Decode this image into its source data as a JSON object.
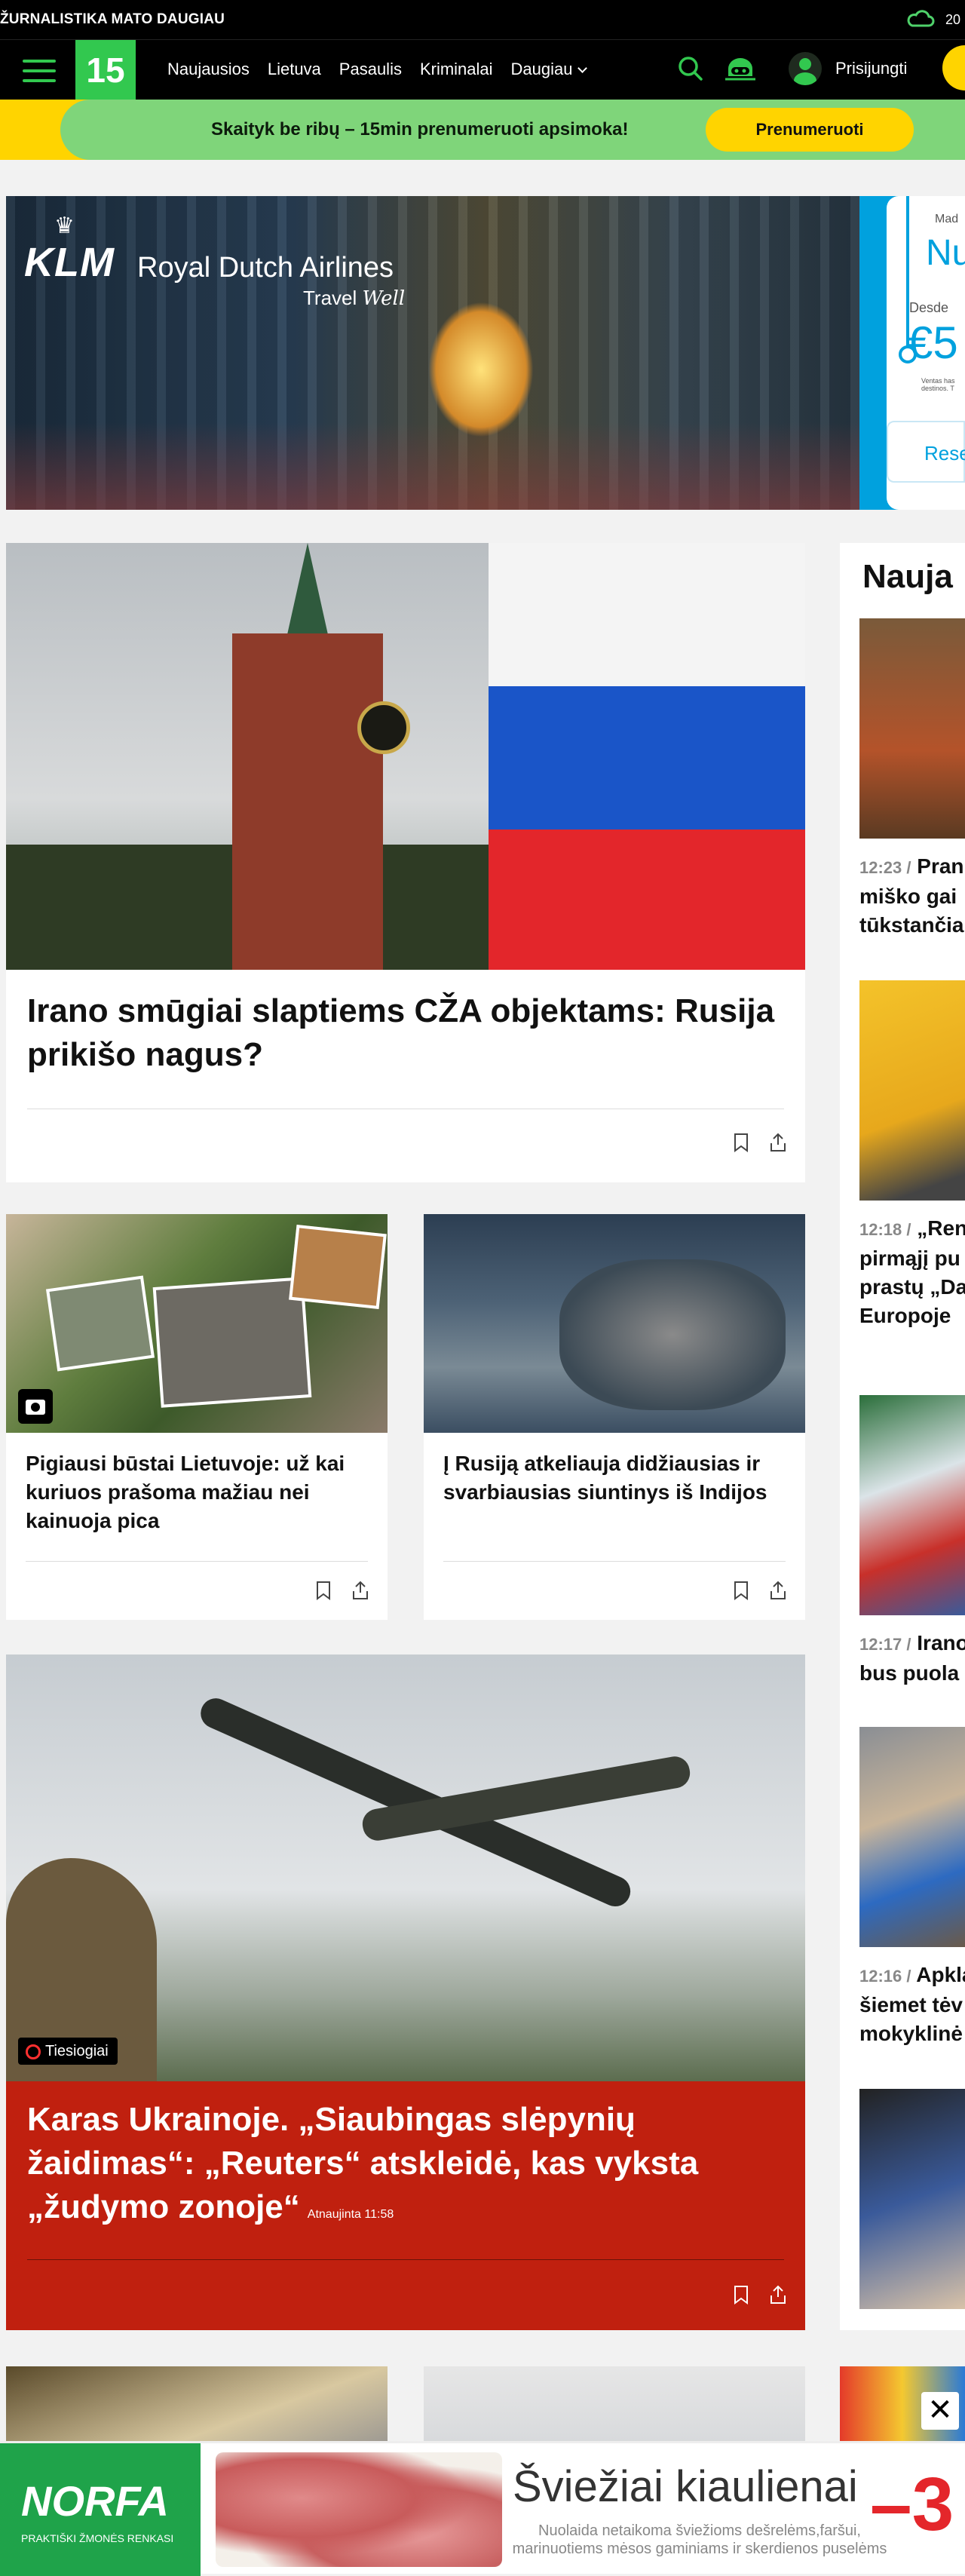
{
  "topbar": {
    "promo": "ŽURNALISTIKA MATO DAUGIAU",
    "temp": "20"
  },
  "nav": {
    "logo": "15",
    "links": [
      "Naujausios",
      "Lietuva",
      "Pasaulis",
      "Kriminalai",
      "Daugiau"
    ],
    "login": "Prisijungti"
  },
  "subscribe": {
    "text": "Skaityk be ribų – 15min prenumeruoti apsimoka!",
    "button": "Prenumeruoti"
  },
  "ad_top": {
    "brand": "KLM",
    "line1": "Royal Dutch Airlines",
    "line2a": "Travel",
    "line2b": "Well",
    "card_m": "Mad",
    "card_n": "Nu",
    "card_d": "Desde",
    "card_p": "€5",
    "card_small": "Ventas has destinos. T",
    "card_button": "Rese"
  },
  "hero": {
    "title": "Irano smūgiai slaptiems CŽA objektams: Rusija prikišo nagus?"
  },
  "small_cards": [
    {
      "title": "Pigiausi būstai Lietuvoje: už kai kuriuos prašoma mažiau nei kainuoja pica"
    },
    {
      "title": "Į Rusiją atkeliauja didžiausias ir svarbiausias siuntinys iš Indijos"
    }
  ],
  "live_story": {
    "badge": "Tiesiogiai",
    "title": "Karas Ukrainoje. „Siaubingas slėpynių žaidimas“: „Reuters“ atskleidė, kas vyksta „žudymo zonoje“",
    "updated": "Atnaujinta 11:58"
  },
  "sidebar": {
    "heading": "Nauja",
    "items": [
      {
        "time": "12:23 /",
        "lines": [
          "Pran",
          "miško gai",
          "tūkstančia"
        ]
      },
      {
        "time": "12:18 /",
        "lines": [
          "„Ren",
          "pirmąjį pu",
          "prastų „Da",
          "Europoje"
        ]
      },
      {
        "time": "12:17 /",
        "lines": [
          "Irano",
          "bus puola"
        ]
      },
      {
        "time": "12:16 /",
        "lines": [
          "Apkla",
          "šiemet tėv",
          "mokyklinė"
        ]
      }
    ]
  },
  "ad_bottom": {
    "brand": "NORFA",
    "tagline": "PRAKTIŠKI ŽMONĖS RENKASI",
    "headline": "Šviežiai kiaulienai",
    "fine": "Nuolaida netaikoma šviežioms dešrelėms,faršui, marinuotiems mėsos gaminiams ir skerdienos puselėms",
    "discount": "–3",
    "close": "✕"
  },
  "colors": {
    "brand_green": "#32c84f",
    "subscribe_yellow": "#ffd400",
    "live_red": "#c0200f",
    "norfa_green": "#1fa34a"
  }
}
